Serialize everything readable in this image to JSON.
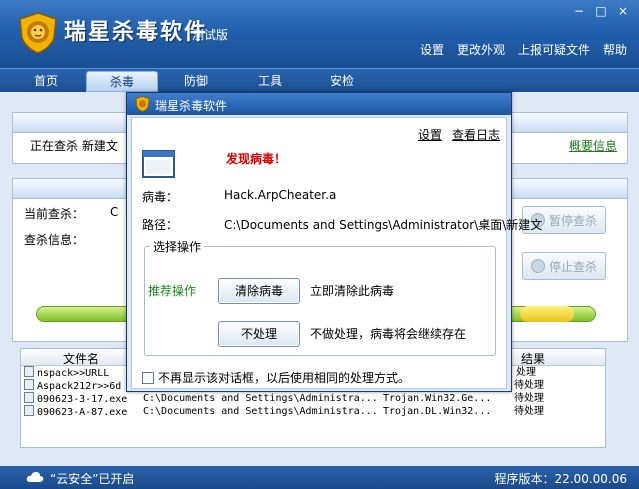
{
  "window": {
    "title": "瑞星杀毒软件",
    "subtitle": "测试版",
    "controls": [
      "−",
      "□",
      "×"
    ]
  },
  "top_menu": [
    "设置",
    "更改外观",
    "上报可疑文件",
    "帮助"
  ],
  "nav_tabs": [
    {
      "label": "首页",
      "active": false
    },
    {
      "label": "杀毒",
      "active": true
    },
    {
      "label": "防御",
      "active": false
    },
    {
      "label": "工具",
      "active": false
    },
    {
      "label": "安检",
      "active": false
    }
  ],
  "background": {
    "scan_status": "正在查杀  新建文",
    "overview_link": "概要信息",
    "current_scan_label": "当前查杀：",
    "current_scan_value": "C",
    "scan_info_label": "查杀信息：",
    "pause_button": "暂停查杀",
    "stop_button": "停止查杀",
    "table": {
      "headers": [
        "文件名",
        "结果"
      ],
      "rows": [
        {
          "file": "nspack>>URLL",
          "path": "",
          "virus": "",
          "result": "处理"
        },
        {
          "file": "Aspack212r>>6d",
          "path": "",
          "virus": "",
          "result": "待处理"
        },
        {
          "file": "090623-3-17.exe",
          "path": "C:\\Documents and Settings\\Administra...",
          "virus": "Trojan.Win32.Ge...",
          "result": "待处理"
        },
        {
          "file": "090623-A-87.exe",
          "path": "C:\\Documents and Settings\\Administra...",
          "virus": "Trojan.DL.Win32...",
          "result": "待处理"
        }
      ]
    }
  },
  "status_bar": {
    "cloud_status": "“云安全”已开启",
    "version": "程序版本：22.00.00.06"
  },
  "dialog": {
    "title": "瑞星杀毒软件",
    "settings_link": "设置",
    "log_link": "查看日志",
    "alert": "发现病毒！",
    "virus_label": "病毒：",
    "virus_name": "Hack.ArpCheater.a",
    "path_label": "路径：",
    "path_value": "C:\\Documents and Settings\\Administrator\\桌面\\新建文",
    "group_title": "选择操作",
    "recommended_label": "推荐操作",
    "clear_button": "清除病毒",
    "clear_desc": "立即清除此病毒",
    "ignore_button": "不处理",
    "ignore_desc": "不做处理，病毒将会继续存在",
    "remember_checkbox": "不再显示该对话框，以后使用相同的处理方式。",
    "remember_checked": false
  },
  "colors": {
    "titlebar": "#2260ad",
    "alert": "#e00000",
    "recommend": "#1a8a1a"
  }
}
